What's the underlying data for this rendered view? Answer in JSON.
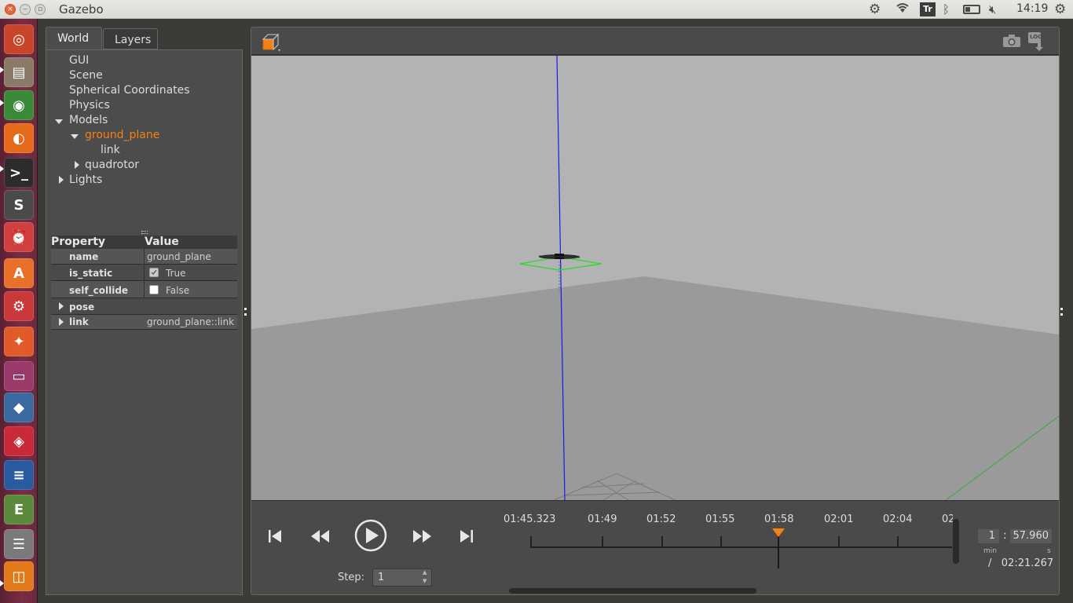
{
  "topbar": {
    "app_title": "Gazebo",
    "clock": "14:19",
    "keyboard_indicator": "Tr",
    "icons": [
      "settings-icon",
      "wifi-icon",
      "keyboard-layout-icon",
      "bluetooth-icon",
      "battery-icon",
      "volume-muted-icon",
      "power-icon"
    ],
    "battery_level": 0.35
  },
  "launcher": {
    "items": [
      {
        "name": "ubuntu-dash",
        "color": "#c8452a"
      },
      {
        "name": "files",
        "color": "#8a7a6a"
      },
      {
        "name": "chrome",
        "color": "#3a8a3a"
      },
      {
        "name": "firefox",
        "color": "#e56a1a"
      },
      {
        "name": "terminal",
        "color": "#2c2c2c"
      },
      {
        "name": "sublime-text",
        "color": "#4a4a4a"
      },
      {
        "name": "alarm-clock",
        "color": "#d04040"
      },
      {
        "name": "software-center",
        "color": "#e8702a"
      },
      {
        "name": "system-settings",
        "color": "#c83a3a"
      },
      {
        "name": "idea",
        "color": "#e05a2a"
      },
      {
        "name": "app-window",
        "color": "#9a3a6a"
      },
      {
        "name": "matlab",
        "color": "#3a6aa0"
      },
      {
        "name": "mendeley",
        "color": "#c82a3a"
      },
      {
        "name": "libreoffice-writer",
        "color": "#2a5aa0"
      },
      {
        "name": "document-viewer",
        "color": "#5a8a3a"
      },
      {
        "name": "stacked-apps",
        "color": "#7a7a7a"
      },
      {
        "name": "gazebo",
        "color": "#e07a1a"
      }
    ]
  },
  "panel": {
    "tabs": [
      {
        "label": "World"
      },
      {
        "label": "Layers"
      }
    ],
    "tree": {
      "gui": "GUI",
      "scene": "Scene",
      "spherical": "Spherical Coordinates",
      "physics": "Physics",
      "models": "Models",
      "ground_plane": "ground_plane",
      "link": "link",
      "quadrotor": "quadrotor",
      "lights": "Lights"
    },
    "properties": {
      "header_property": "Property",
      "header_value": "Value",
      "rows": {
        "name": {
          "key": "name",
          "value": "ground_plane"
        },
        "is_static": {
          "key": "is_static",
          "value": "True",
          "checked": true
        },
        "self_collide": {
          "key": "self_collide",
          "value": "False",
          "checked": false
        },
        "pose": {
          "key": "pose",
          "value": ""
        },
        "link": {
          "key": "link",
          "value": "ground_plane::link"
        }
      }
    }
  },
  "viewport": {
    "toolbar_icons": [
      "view-angle-cube-icon",
      "screenshot-camera-icon",
      "log-record-icon"
    ],
    "log_label": "LOG"
  },
  "timeline": {
    "ticks": [
      "01:45.323",
      "01:49",
      "01:52",
      "01:55",
      "01:58",
      "02:01",
      "02:04",
      "02:"
    ],
    "step_label": "Step:",
    "step_value": "1",
    "minutes": "1",
    "colon": ":",
    "seconds": "57.960",
    "min_unit": "min",
    "sec_unit": "s",
    "total": "/   02:21.267"
  },
  "colors": {
    "accent_orange": "#f58113",
    "panel_bg": "#4c4c4c",
    "scene_sky": "#b3b3b3",
    "scene_ground": "#9a9a9a"
  }
}
